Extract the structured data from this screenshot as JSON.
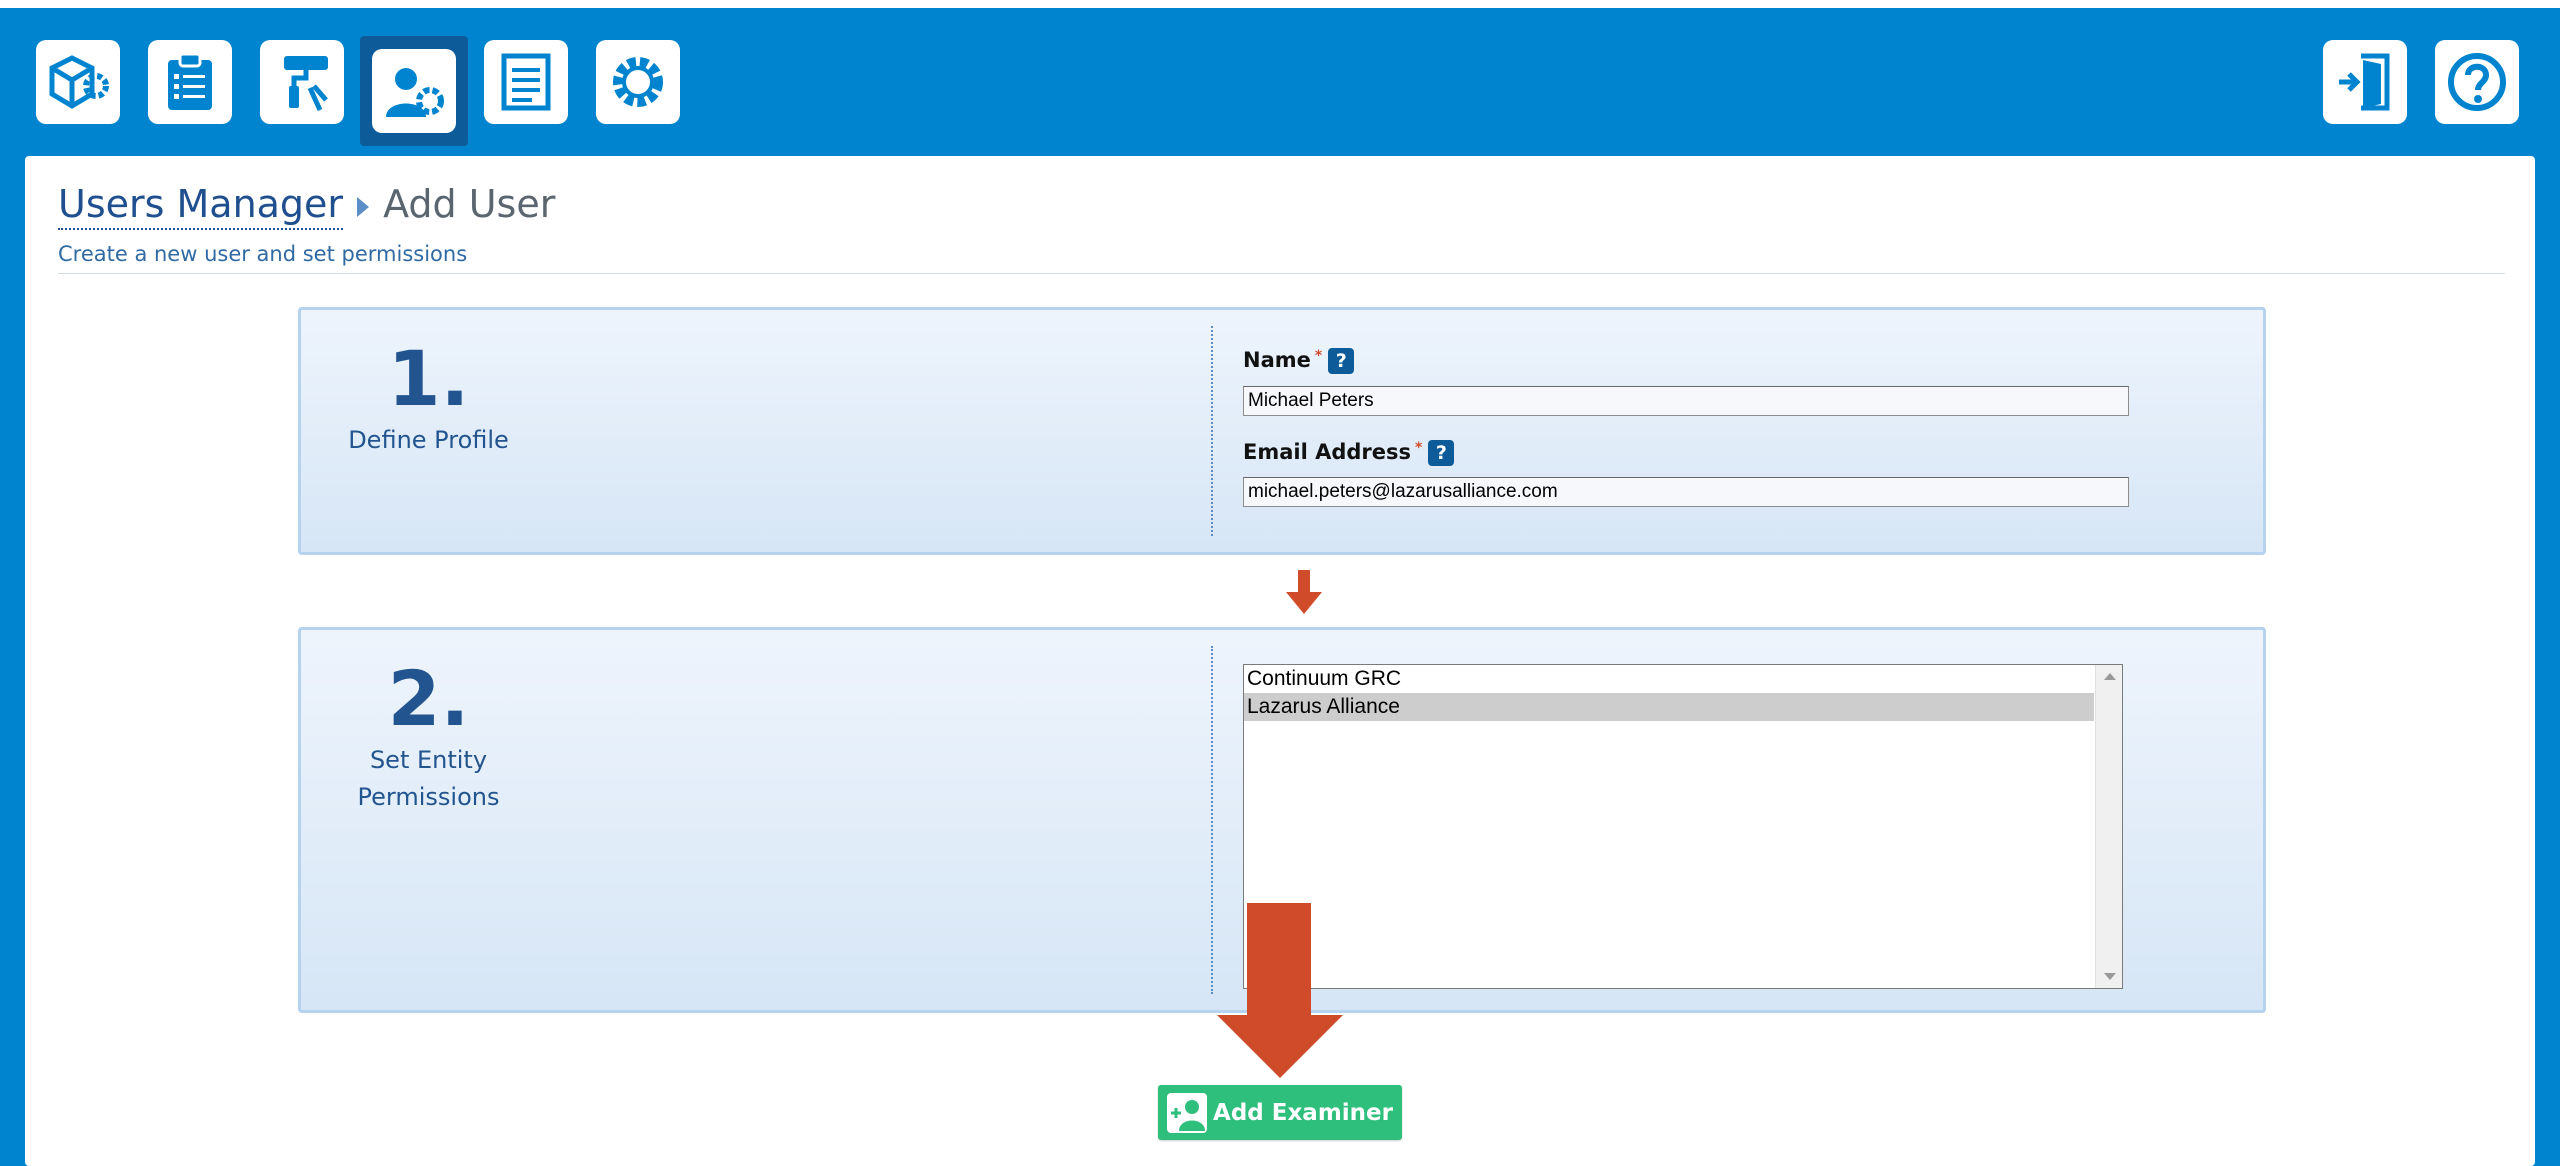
{
  "toolbar": {
    "tools": [
      {
        "icon": "assets-settings-icon"
      },
      {
        "icon": "clipboard-checklist-icon"
      },
      {
        "icon": "paint-roller-tools-icon"
      },
      {
        "icon": "users-settings-icon",
        "active": true
      },
      {
        "icon": "document-list-icon"
      },
      {
        "icon": "gear-icon"
      }
    ],
    "right_tools": [
      {
        "icon": "exit-door-icon"
      },
      {
        "icon": "help-icon"
      }
    ]
  },
  "breadcrumb": {
    "parent": "Users Manager",
    "current": "Add User"
  },
  "subtitle": "Create a new user and set permissions",
  "step1": {
    "number": "1.",
    "label": "Define Profile",
    "name_label": "Name",
    "name_value": "Michael Peters",
    "email_label": "Email Address",
    "email_value": "michael.peters@lazarusalliance.com",
    "required_mark": "*"
  },
  "step2": {
    "number": "2.",
    "label_line1": "Set Entity",
    "label_line2": "Permissions",
    "entities": [
      {
        "name": "Continuum GRC",
        "selected": false
      },
      {
        "name": "Lazarus Alliance",
        "selected": true
      }
    ]
  },
  "submit": {
    "label": "Add Examiner",
    "icon": "add-user-icon"
  },
  "colors": {
    "header_blue": "#0084cf",
    "active_tool": "#0d5c99",
    "arrow_red": "#d04b2a",
    "button_green": "#2fbf7c"
  }
}
